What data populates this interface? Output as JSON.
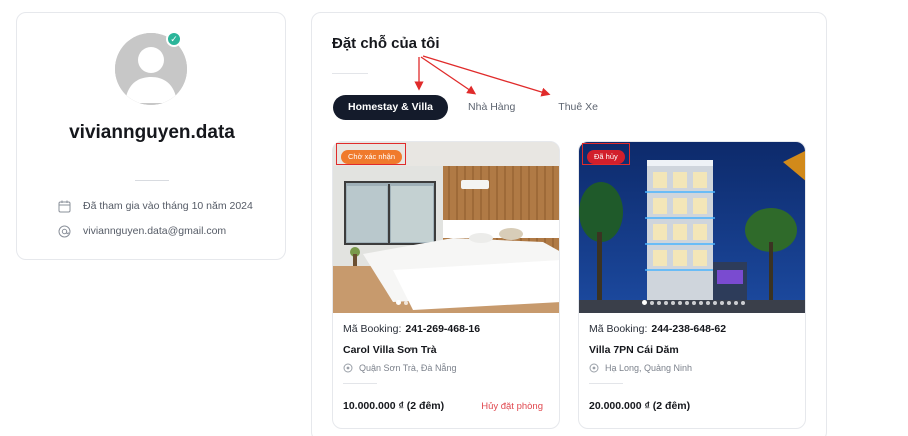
{
  "profile": {
    "username": "viviannguyen.data",
    "joined": "Đã tham gia vào tháng 10 năm 2024",
    "email": "viviannguyen.data@gmail.com"
  },
  "bookings": {
    "title": "Đặt chỗ của tôi",
    "tabs": [
      {
        "label": "Homestay & Villa",
        "active": true
      },
      {
        "label": "Nhà Hàng",
        "active": false
      },
      {
        "label": "Thuê Xe",
        "active": false
      }
    ],
    "items": [
      {
        "status": "Chờ xác nhận",
        "code_label": "Mã Booking:",
        "code": "241-269-468-16",
        "name": "Carol Villa Sơn Trà",
        "location": "Quận Sơn Trà, Đà Nẵng",
        "price": "10.000.000 ₫ (2 đêm)",
        "cancel_label": "Hủy đặt phòng",
        "photo_count": 15
      },
      {
        "status": "Đã hủy",
        "code_label": "Mã Booking:",
        "code": "244-238-648-62",
        "name": "Villa 7PN Cái Dăm",
        "location": "Hạ Long, Quảng Ninh",
        "price": "20.000.000 ₫ (2 đêm)",
        "photo_count": 15
      }
    ]
  },
  "colors": {
    "active_tab": "#141b2b",
    "pending_badge": "#f07a2c",
    "cancelled_badge": "#d21f2c",
    "cancel_link": "#e0484f",
    "verified": "#2bb59a",
    "annotation": "#e02b2b"
  },
  "icons": [
    "verified-check-icon",
    "calendar-icon",
    "at-sign-icon",
    "location-pin-icon"
  ]
}
